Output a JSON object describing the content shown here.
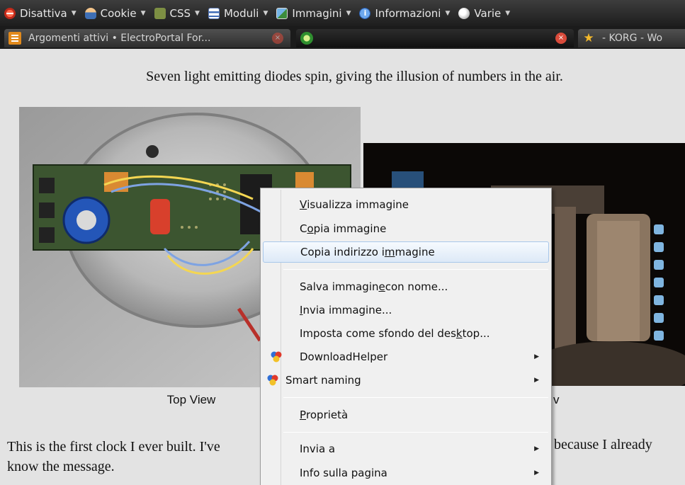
{
  "toolbar": {
    "items": [
      {
        "label": "Disattiva",
        "icon": "disable-icon"
      },
      {
        "label": "Cookie",
        "icon": "cookie-icon"
      },
      {
        "label": "CSS",
        "icon": "css-icon"
      },
      {
        "label": "Moduli",
        "icon": "forms-icon"
      },
      {
        "label": "Immagini",
        "icon": "images-icon"
      },
      {
        "label": "Informazioni",
        "icon": "info-icon"
      },
      {
        "label": "Varie",
        "icon": "misc-icon"
      }
    ],
    "dropdown_glyph": "▼"
  },
  "tabs": [
    {
      "title": "Argomenti attivi • ElectroPortal For...",
      "icon": "forum-favicon",
      "close": "×"
    },
    {
      "title": "",
      "icon": "sun-favicon",
      "close": "×"
    },
    {
      "title": "- KORG - Wo",
      "icon": "star-favicon"
    }
  ],
  "page": {
    "caption": "Seven light emitting diodes spin, giving the illusion of numbers in the air.",
    "top_view_label": "Top View",
    "side_view_label_fragment": "v",
    "paragraph_left_line1": "This is the first clock I ever built. I've",
    "paragraph_right_line1": "because I already",
    "paragraph_line2": "know the message."
  },
  "context_menu": {
    "items": [
      {
        "label_pre": "",
        "accel": "V",
        "label_post": "isualizza immagine"
      },
      {
        "label_pre": "C",
        "accel": "o",
        "label_post": "pia immagine"
      },
      {
        "label_pre": "Copia indirizzo i",
        "accel": "m",
        "label_post": "magine",
        "highlighted": true
      },
      {
        "label_pre": "Salva immagin",
        "accel": "e",
        "label_post": " con nome..."
      },
      {
        "label_pre": "",
        "accel": "I",
        "label_post": "nvia immagine..."
      },
      {
        "label_pre": "Imposta come sfondo del des",
        "accel": "k",
        "label_post": "top..."
      },
      {
        "label": "DownloadHelper",
        "icon": "downloadhelper-icon",
        "submenu": true
      },
      {
        "label": "Smart naming",
        "icon": "smart-naming-icon",
        "submenu": true
      },
      {
        "label_pre": "",
        "accel": "P",
        "label_post": "roprietà"
      },
      {
        "label": "Invia a",
        "submenu": true
      },
      {
        "label": "Info sulla pagina",
        "submenu": true
      }
    ],
    "submenu_glyph": "▶"
  }
}
